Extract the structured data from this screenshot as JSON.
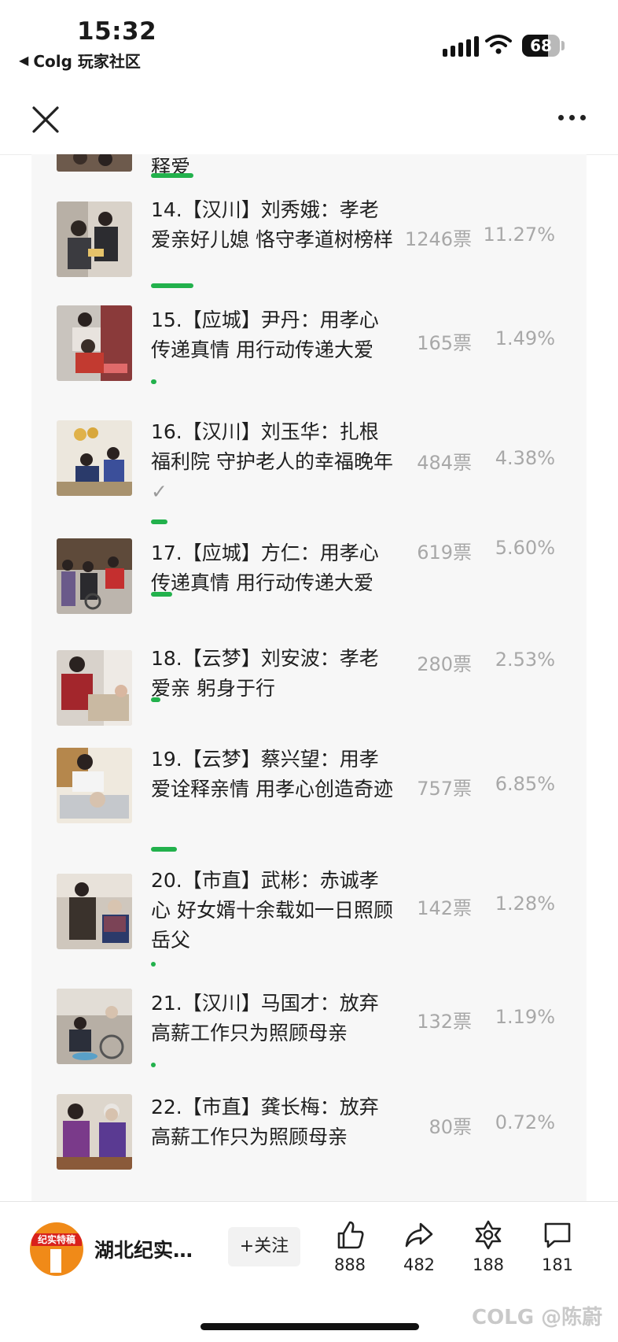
{
  "status_bar": {
    "time": "15:32",
    "back_app": "Colg 玩家社区",
    "battery": "68",
    "battery_level": 0.68
  },
  "nav": {
    "close_icon": "close-icon",
    "more_icon": "more-dots-icon"
  },
  "partial_item": {
    "title": "释爱"
  },
  "items": [
    {
      "title": "14.【汉川】刘秀娥：孝老爱亲好儿媳 恪守孝道树榜样",
      "votes": "1246票",
      "percent": "11.27%",
      "share": 0.1127,
      "checked": false
    },
    {
      "title": "15.【应城】尹丹：用孝心传递真情 用行动传递大爱",
      "votes": "165票",
      "percent": "1.49%",
      "share": 0.0149,
      "checked": false
    },
    {
      "title": "16.【汉川】刘玉华：扎根福利院 守护老人的幸福晚年",
      "votes": "484票",
      "percent": "4.38%",
      "share": 0.0438,
      "checked": true
    },
    {
      "title": "17.【应城】方仁：用孝心传递真情 用行动传递大爱",
      "votes": "619票",
      "percent": "5.60%",
      "share": 0.056,
      "checked": false
    },
    {
      "title": "18.【云梦】刘安波：孝老爱亲 躬身于行",
      "votes": "280票",
      "percent": "2.53%",
      "share": 0.0253,
      "checked": false
    },
    {
      "title": "19.【云梦】蔡兴望：用孝爱诠释亲情 用孝心创造奇迹",
      "votes": "757票",
      "percent": "6.85%",
      "share": 0.0685,
      "checked": false
    },
    {
      "title": "20.【市直】武彬：赤诚孝心 好女婿十余载如一日照顾岳父",
      "votes": "142票",
      "percent": "1.28%",
      "share": 0.0128,
      "checked": false
    },
    {
      "title": "21.【汉川】马国才：放弃高薪工作只为照顾母亲",
      "votes": "132票",
      "percent": "1.19%",
      "share": 0.0119,
      "checked": false
    },
    {
      "title": "22.【市直】龚长梅：放弃高薪工作只为照顾母亲",
      "votes": "80票",
      "percent": "0.72%",
      "share": 0.0072,
      "checked": false
    }
  ],
  "bottom_bar": {
    "account_name": "湖北纪实…",
    "logo_text": "纪实特稿",
    "follow_label": "+关注",
    "actions": [
      {
        "icon": "thumb-up-icon",
        "count": "888"
      },
      {
        "icon": "share-icon",
        "count": "482"
      },
      {
        "icon": "collect-icon",
        "count": "188"
      },
      {
        "icon": "comment-icon",
        "count": "181"
      }
    ]
  },
  "watermark": "COLG @陈蔚",
  "colors": {
    "accent_bar": "#22b14c",
    "card_bg": "#f7f7f7",
    "muted_text": "#a8a8a8"
  }
}
